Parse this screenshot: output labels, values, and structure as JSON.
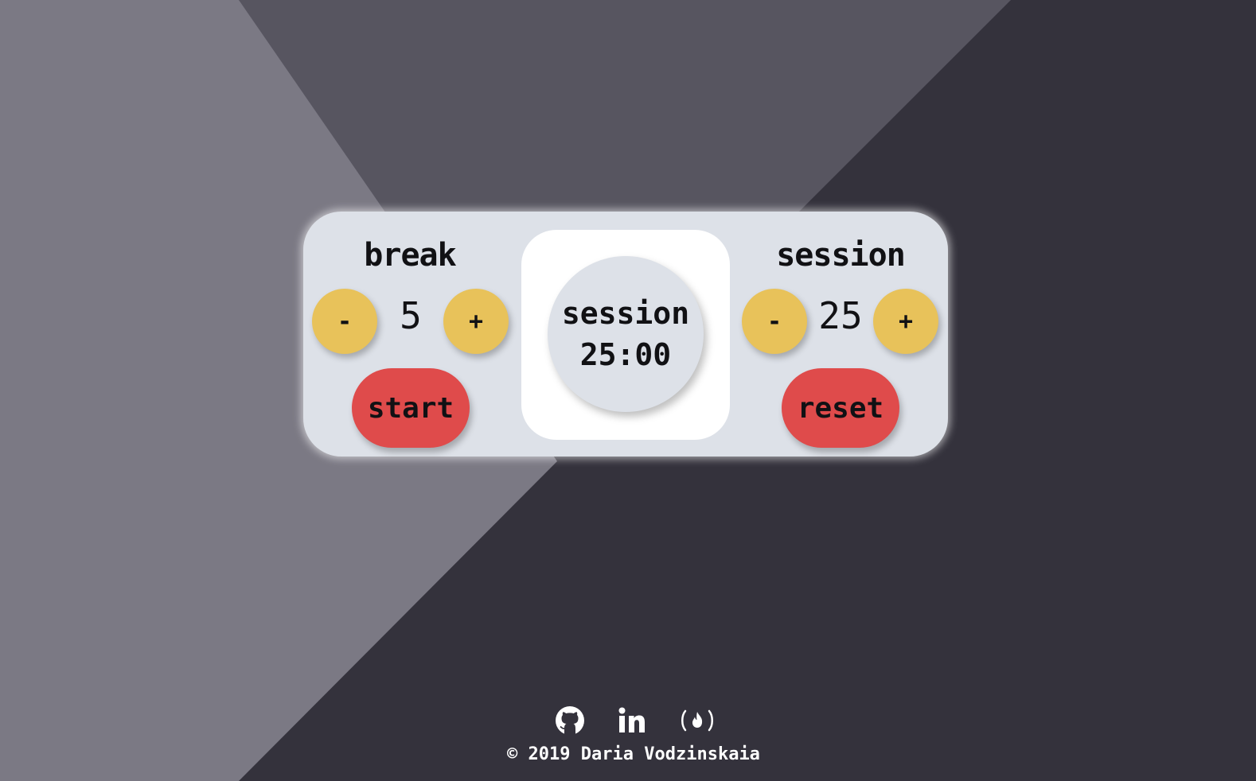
{
  "colors": {
    "background_dark": "#34323c",
    "background_mid": "#575560",
    "background_light": "#7b7984",
    "panel": "#dde1e8",
    "adjust_button": "#e8c25a",
    "action_button": "#df4b4b",
    "text": "#111114"
  },
  "break": {
    "label": "break",
    "value": "5",
    "decrement_label": "-",
    "increment_label": "+"
  },
  "session": {
    "label": "session",
    "value": "25",
    "decrement_label": "-",
    "increment_label": "+"
  },
  "timer": {
    "label": "session",
    "time": "25:00"
  },
  "controls": {
    "start_label": "start",
    "reset_label": "reset"
  },
  "footer": {
    "links": [
      {
        "icon": "github-icon"
      },
      {
        "icon": "linkedin-icon"
      },
      {
        "icon": "freecodecamp-icon"
      }
    ],
    "copyright": "© 2019 Daria Vodzinskaia"
  }
}
